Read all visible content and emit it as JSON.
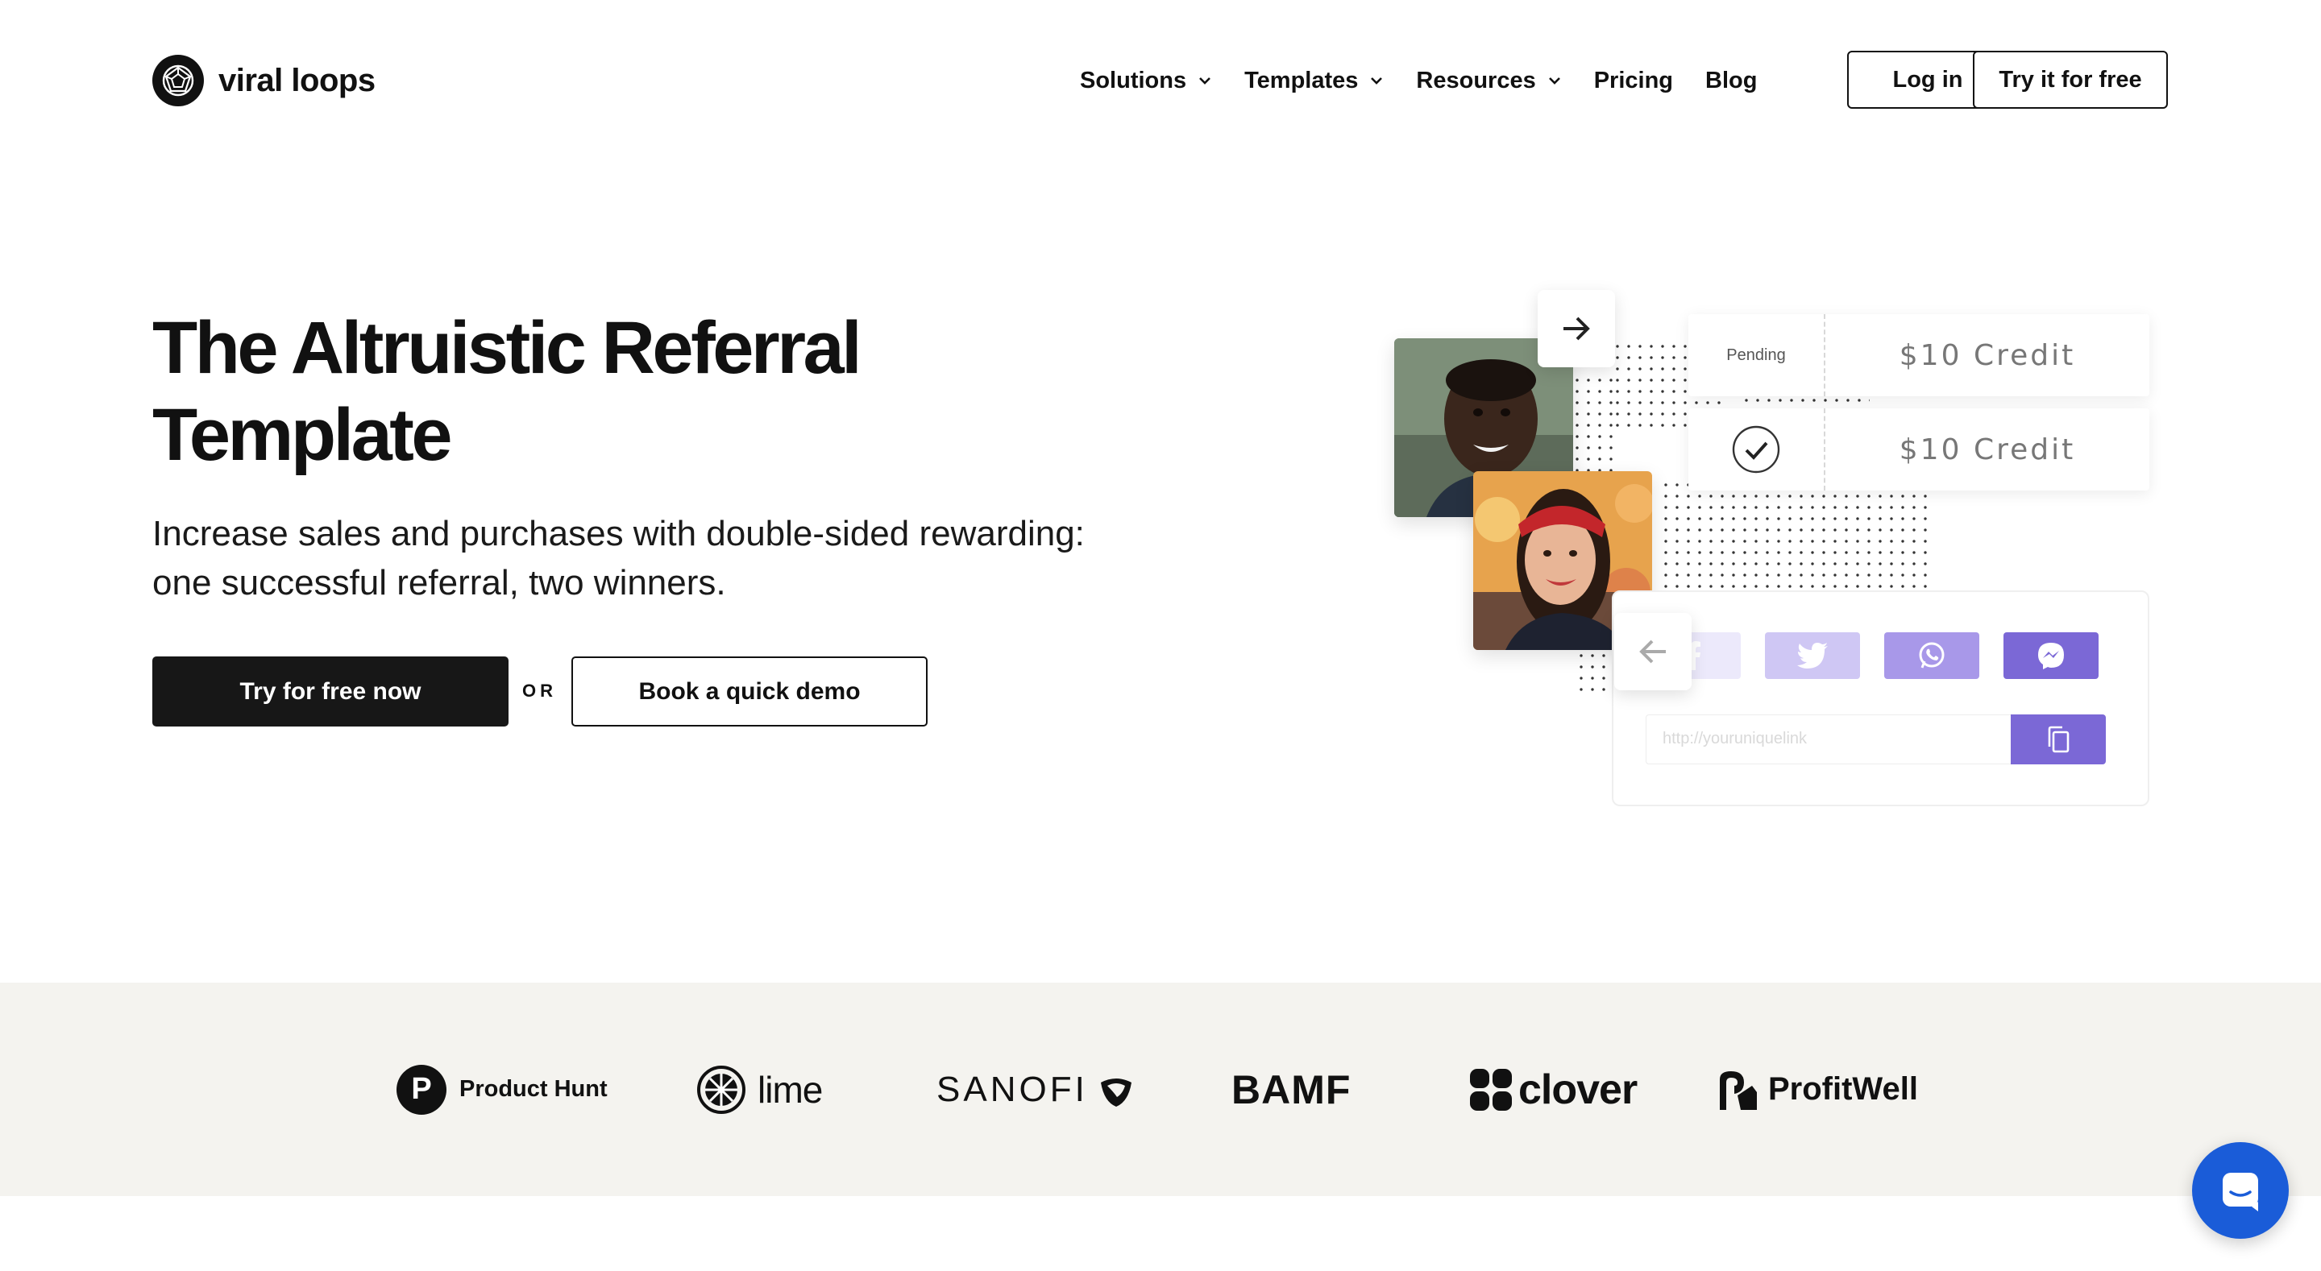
{
  "header": {
    "logo_text": "viral loops",
    "nav": [
      {
        "label": "Solutions",
        "has_dropdown": true
      },
      {
        "label": "Templates",
        "has_dropdown": true
      },
      {
        "label": "Resources",
        "has_dropdown": true
      },
      {
        "label": "Pricing",
        "has_dropdown": false
      },
      {
        "label": "Blog",
        "has_dropdown": false
      }
    ],
    "login_label": "Log in",
    "try_label": "Try it for free"
  },
  "hero": {
    "title_line1": "The Altruistic Referral",
    "title_line2": "Template",
    "subtitle_line1": "Increase sales and purchases with double-sided rewarding:",
    "subtitle_line2": "one successful referral, two winners.",
    "primary_cta": "Try for free now",
    "or_text": "OR",
    "secondary_cta": "Book a quick demo"
  },
  "illustration": {
    "rewards": [
      {
        "status": "Pending",
        "value": "$10 Credit"
      },
      {
        "status": "check-icon",
        "value": "$10 Credit"
      }
    ],
    "share_buttons": [
      {
        "icon": "facebook-icon",
        "color": "#ece9fb"
      },
      {
        "icon": "twitter-icon",
        "color": "#cfc7f4"
      },
      {
        "icon": "whatsapp-icon",
        "color": "#a898e9"
      },
      {
        "icon": "messenger-icon",
        "color": "#7b68d6"
      }
    ],
    "link_placeholder": "http://youruniquelink",
    "accent": "#7b68d6"
  },
  "logos": {
    "product_hunt": {
      "letter": "P",
      "name": "Product Hunt"
    },
    "lime": "lime",
    "sanofi": "SANOFI",
    "bamf": "BAMF",
    "clover": "clover",
    "profitwell": "ProfitWell"
  },
  "colors": {
    "dark": "#171717",
    "strip_bg": "#f4f3ef",
    "chat": "#1a5cd8"
  }
}
